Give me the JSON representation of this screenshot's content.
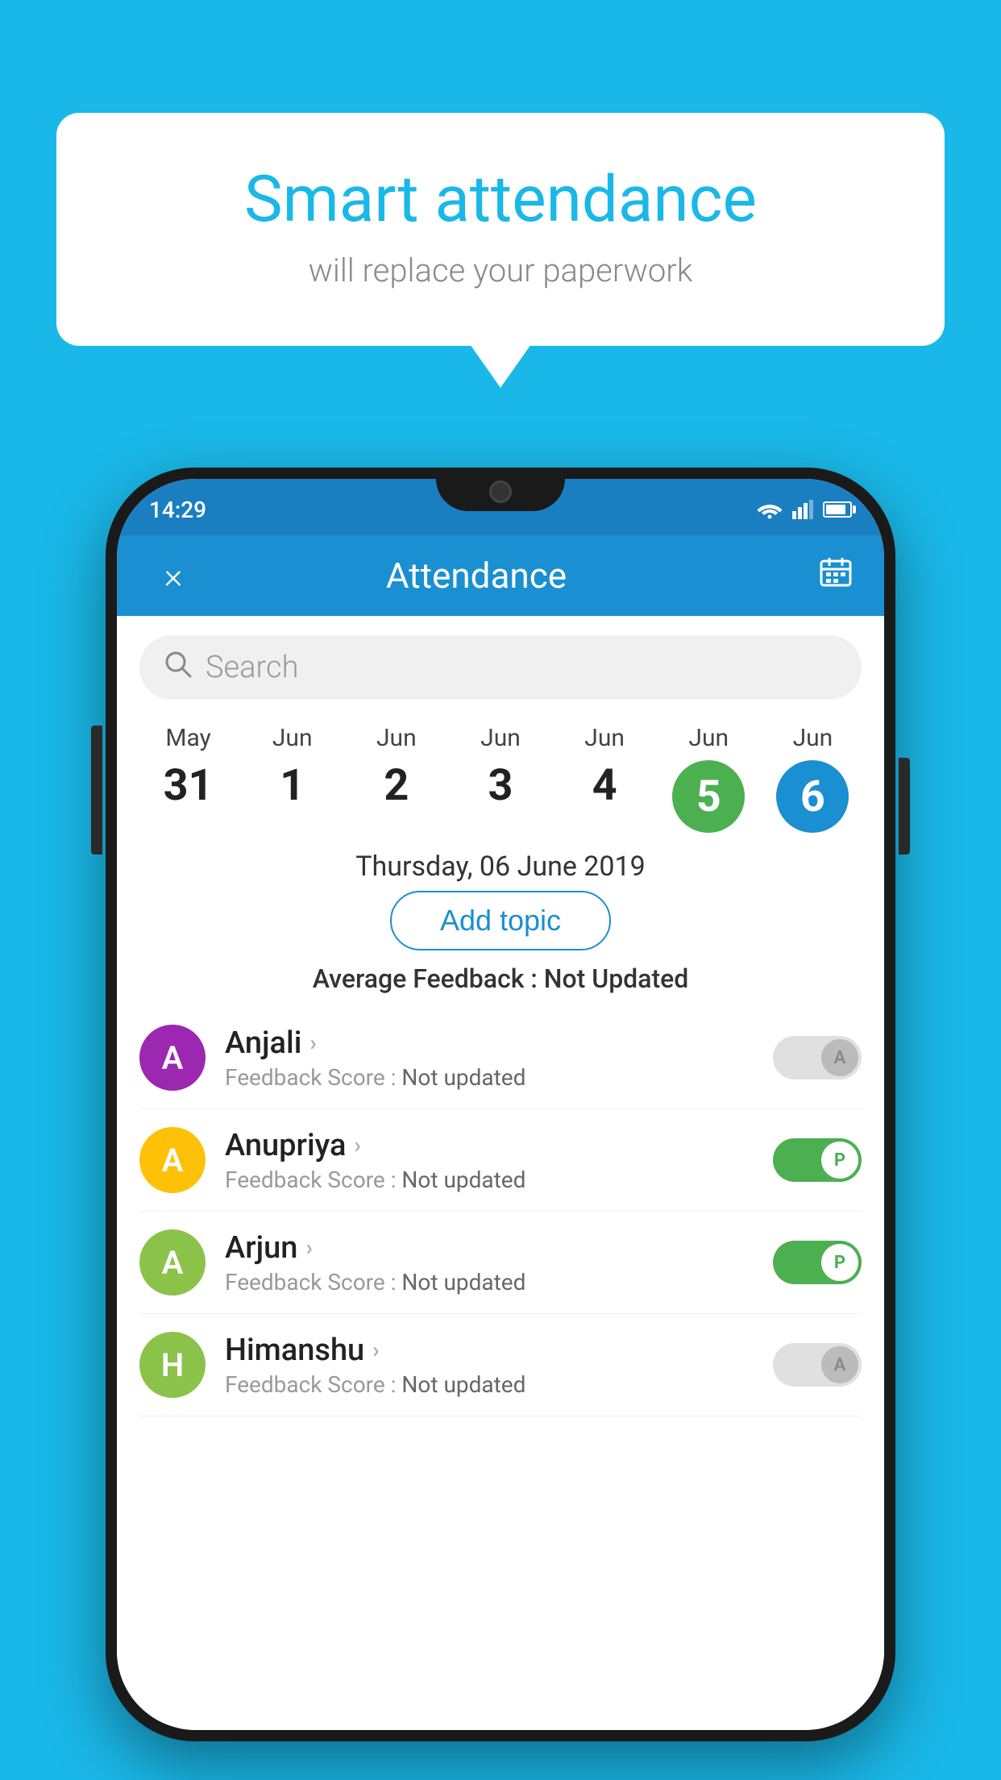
{
  "background": {
    "color": "#1ab8e8"
  },
  "speech_bubble": {
    "title": "Smart attendance",
    "subtitle": "will replace your paperwork"
  },
  "status_bar": {
    "time": "14:29"
  },
  "header": {
    "title": "Attendance",
    "close_label": "×",
    "calendar_icon": "📅"
  },
  "search": {
    "placeholder": "Search"
  },
  "dates": [
    {
      "month": "May",
      "day": "31",
      "highlight": "none"
    },
    {
      "month": "Jun",
      "day": "1",
      "highlight": "none"
    },
    {
      "month": "Jun",
      "day": "2",
      "highlight": "none"
    },
    {
      "month": "Jun",
      "day": "3",
      "highlight": "none"
    },
    {
      "month": "Jun",
      "day": "4",
      "highlight": "none"
    },
    {
      "month": "Jun",
      "day": "5",
      "highlight": "green"
    },
    {
      "month": "Jun",
      "day": "6",
      "highlight": "blue"
    }
  ],
  "selected_date": "Thursday, 06 June 2019",
  "add_topic_label": "Add topic",
  "avg_feedback_label": "Average Feedback : ",
  "avg_feedback_value": "Not Updated",
  "students": [
    {
      "name": "Anjali",
      "initial": "A",
      "avatar_color": "#9c27b0",
      "feedback_label": "Feedback Score : ",
      "feedback_value": "Not updated",
      "toggle": "off",
      "toggle_label": "A"
    },
    {
      "name": "Anupriya",
      "initial": "A",
      "avatar_color": "#ffc107",
      "feedback_label": "Feedback Score : ",
      "feedback_value": "Not updated",
      "toggle": "on",
      "toggle_label": "P"
    },
    {
      "name": "Arjun",
      "initial": "A",
      "avatar_color": "#8bc34a",
      "feedback_label": "Feedback Score : ",
      "feedback_value": "Not updated",
      "toggle": "on",
      "toggle_label": "P"
    },
    {
      "name": "Himanshu",
      "initial": "H",
      "avatar_color": "#8bc34a",
      "feedback_label": "Feedback Score : ",
      "feedback_value": "Not updated",
      "toggle": "off",
      "toggle_label": "A"
    }
  ]
}
